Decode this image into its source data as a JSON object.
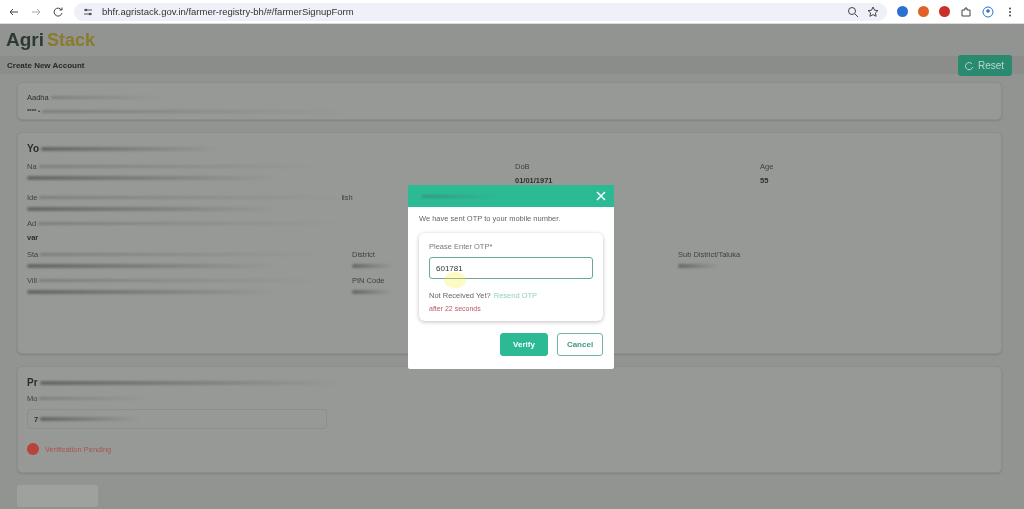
{
  "browser": {
    "url": "bhfr.agristack.gov.in/farmer-registry-bh/#/farmerSignupForm"
  },
  "header": {
    "logo": [
      "Agri",
      "Stack"
    ]
  },
  "title_bar": {
    "title": "Create New Account",
    "reset_button": "Reset"
  },
  "aadhaar_card": {
    "label": "Aadha",
    "value": "**** •"
  },
  "personal_card": {
    "heading": "Yo",
    "rows": [
      {
        "kind": "top",
        "fields": [
          {
            "label": "Na"
          },
          {
            "label": "DoB",
            "value": "01/01/1971"
          },
          {
            "label": "Age",
            "value": "55"
          }
        ]
      },
      {
        "kind": "single",
        "fields": [
          {
            "label": "Ide",
            "suffix": "lish"
          }
        ]
      },
      {
        "kind": "single",
        "fields": [
          {
            "label": "Ad",
            "value": "var"
          }
        ]
      },
      {
        "kind": "mid",
        "fields": [
          {
            "label": "Sta"
          },
          {
            "label": "District"
          },
          {
            "label": "Sub District/Taluka"
          }
        ]
      },
      {
        "kind": "mid",
        "fields": [
          {
            "label": "Vill"
          },
          {
            "label": "PIN Code"
          }
        ]
      }
    ]
  },
  "mobile_card": {
    "heading": "Pr",
    "label": "Mo",
    "value": "7",
    "status": "Verification Pending"
  },
  "modal": {
    "message": "We have sent OTP to your mobile number.",
    "otp_label": "Please Enter OTP*",
    "otp_value": "601781",
    "resend_prompt": "Not Received Yet?",
    "resend_link": "Resend OTP",
    "timer": "after 22 seconds",
    "buttons": [
      {
        "label": "Verify",
        "kind": "primary"
      },
      {
        "label": "Cancel",
        "kind": "secondary"
      }
    ]
  }
}
